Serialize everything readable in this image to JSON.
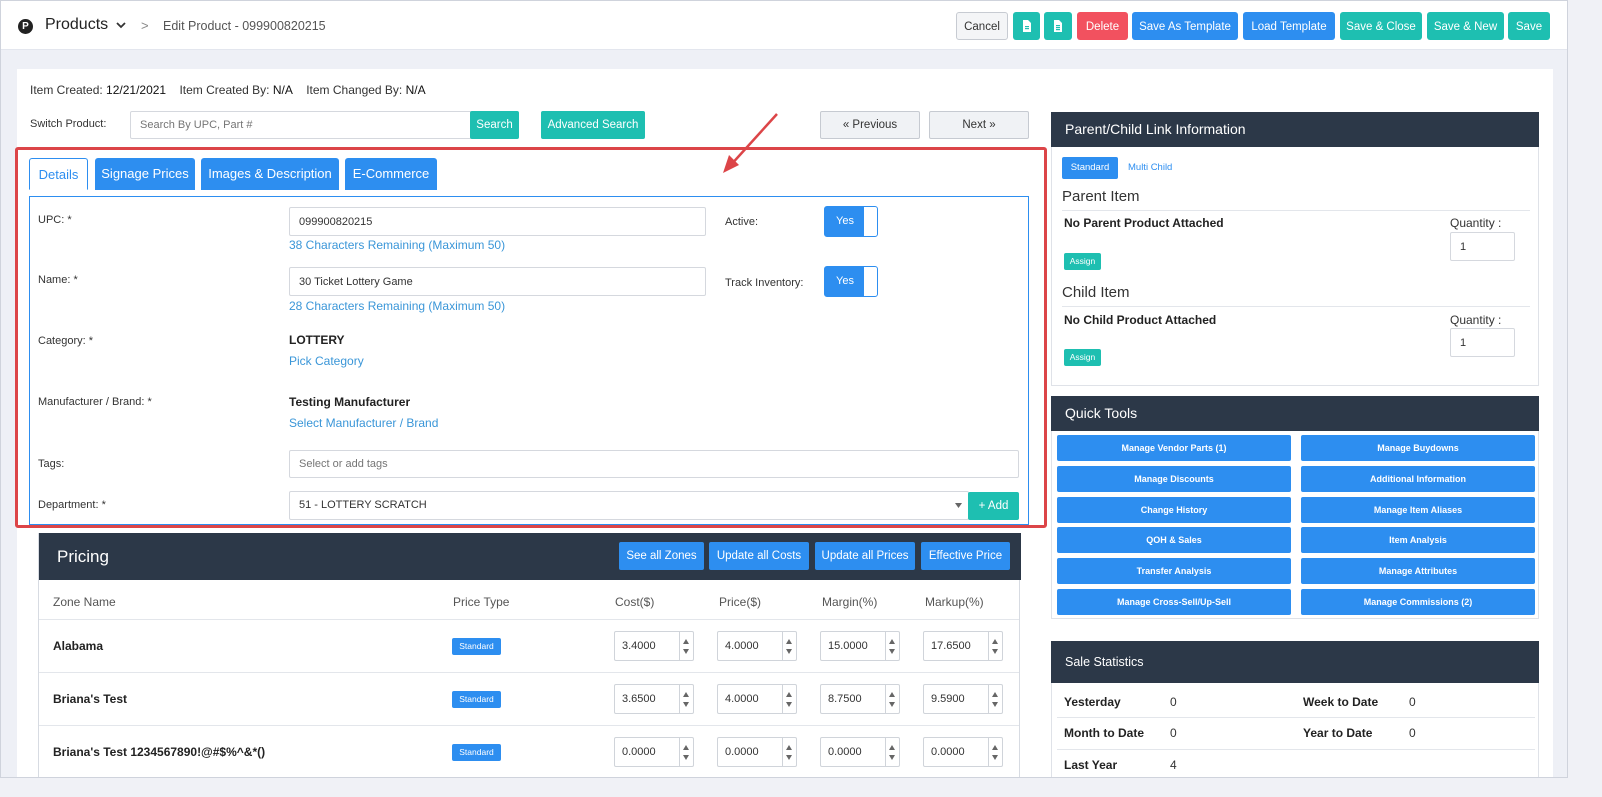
{
  "header": {
    "app_initial": "P",
    "app_title": "Products",
    "breadcrumb_sep": ">",
    "breadcrumb": "Edit Product - 099900820215",
    "buttons": {
      "cancel": "Cancel",
      "delete": "Delete",
      "save_as_template": "Save As Template",
      "load_template": "Load Template",
      "save_close": "Save & Close",
      "save_new": "Save & New",
      "save": "Save"
    }
  },
  "meta": {
    "created_label": "Item Created:",
    "created_value": "12/21/2021",
    "created_by_label": "Item Created By:",
    "created_by_value": "N/A",
    "changed_by_label": "Item Changed By:",
    "changed_by_value": "N/A"
  },
  "switch": {
    "label": "Switch Product:",
    "placeholder": "Search By UPC, Part #",
    "search": "Search",
    "advanced": "Advanced Search",
    "previous": "« Previous",
    "next": "Next »"
  },
  "tabs": [
    "Details",
    "Signage Prices",
    "Images & Description",
    "E-Commerce"
  ],
  "details": {
    "upc_label": "UPC: *",
    "upc_value": "099900820215",
    "upc_hint": "38 Characters Remaining (Maximum 50)",
    "name_label": "Name: *",
    "name_value": "30 Ticket Lottery Game",
    "name_hint": "28 Characters Remaining (Maximum 50)",
    "active_label": "Active:",
    "active_value": "Yes",
    "track_label": "Track Inventory:",
    "track_value": "Yes",
    "category_label": "Category: *",
    "category_value": "LOTTERY",
    "category_link": "Pick Category",
    "manufacturer_label": "Manufacturer / Brand: *",
    "manufacturer_value": "Testing Manufacturer",
    "manufacturer_link": "Select Manufacturer / Brand",
    "tags_label": "Tags:",
    "tags_placeholder": "Select or add tags",
    "department_label": "Department: *",
    "department_value": "51 - LOTTERY SCRATCH",
    "add": "Add"
  },
  "pricing": {
    "title": "Pricing",
    "buttons": [
      "See all Zones",
      "Update all Costs",
      "Update all Prices",
      "Effective Price"
    ],
    "columns": [
      "Zone Name",
      "Price Type",
      "Cost($)",
      "Price($)",
      "Margin(%)",
      "Markup(%)"
    ],
    "rows": [
      {
        "zone": "Alabama",
        "type": "Standard",
        "cost": "3.4000",
        "price": "4.0000",
        "margin": "15.0000",
        "markup": "17.6500"
      },
      {
        "zone": "Briana's Test",
        "type": "Standard",
        "cost": "3.6500",
        "price": "4.0000",
        "margin": "8.7500",
        "markup": "9.5900"
      },
      {
        "zone": "Briana's Test 1234567890!@#$%^&*()",
        "type": "Standard",
        "cost": "0.0000",
        "price": "0.0000",
        "margin": "0.0000",
        "markup": "0.0000"
      }
    ]
  },
  "parent_child": {
    "title": "Parent/Child Link Information",
    "standard": "Standard",
    "multi_child": "Multi Child",
    "parent_heading": "Parent Item",
    "parent_none": "No Parent Product Attached",
    "child_heading": "Child Item",
    "child_none": "No Child Product Attached",
    "quantity_label": "Quantity :",
    "quantity_value": "1",
    "assign": "Assign"
  },
  "quick_tools": {
    "title": "Quick Tools",
    "items": [
      "Manage Vendor Parts (1)",
      "Manage Buydowns",
      "Manage Discounts",
      "Additional Information",
      "Change History",
      "Manage Item Aliases",
      "QOH & Sales",
      "Item Analysis",
      "Transfer Analysis",
      "Manage Attributes",
      "Manage Cross-Sell/Up-Sell",
      "Manage Commissions (2)"
    ]
  },
  "sale_stats": {
    "title": "Sale Statistics",
    "yesterday_label": "Yesterday",
    "yesterday_value": "0",
    "week_label": "Week to Date",
    "week_value": "0",
    "month_label": "Month to Date",
    "month_value": "0",
    "year_label": "Year to Date",
    "year_value": "0",
    "last_year_label": "Last Year",
    "last_year_value": "4"
  },
  "colors": {
    "teal": "#1ebfb1",
    "blue": "#2d8ef0",
    "red": "#f2515f",
    "dark": "#2c3848",
    "annotation": "#dc4548"
  }
}
